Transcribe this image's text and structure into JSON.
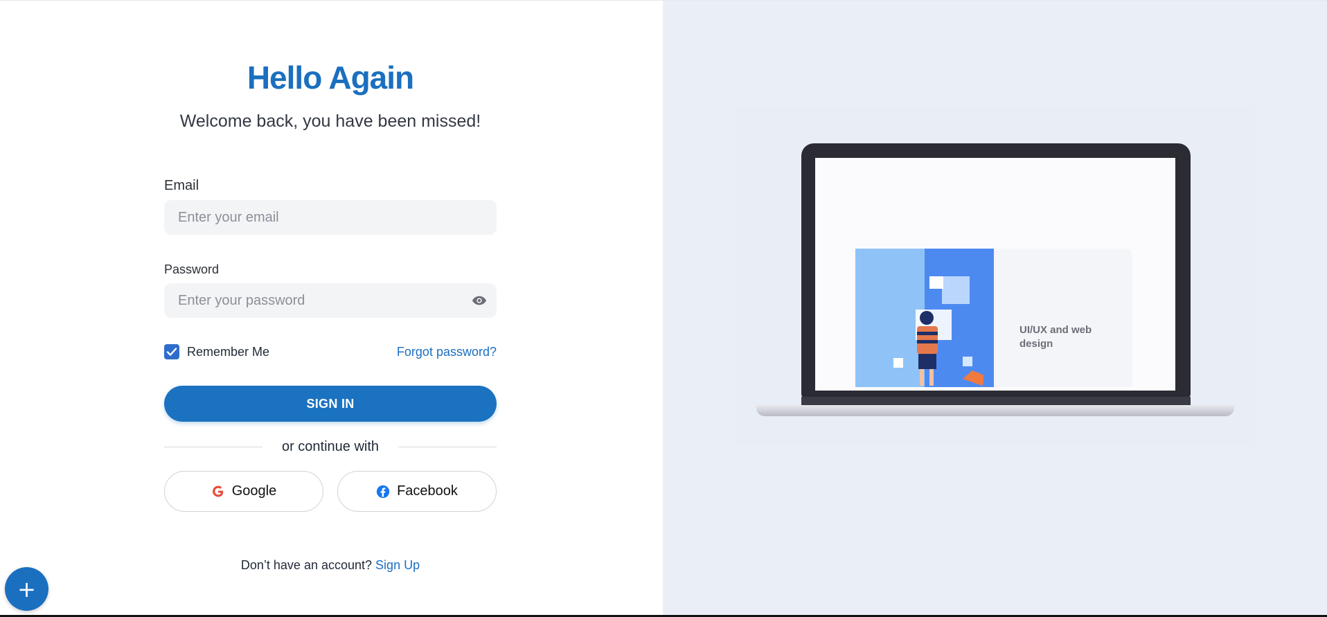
{
  "title": "Hello Again",
  "subtitle": "Welcome back, you have been missed!",
  "email": {
    "label": "Email",
    "placeholder": "Enter your email",
    "value": ""
  },
  "password": {
    "label": "Password",
    "placeholder": "Enter your password",
    "value": ""
  },
  "remember": {
    "label": "Remember Me",
    "checked": true
  },
  "forgot_label": "Forgot password?",
  "signin_label": "SIGN IN",
  "divider_text": "or continue with",
  "social": {
    "google_label": "Google",
    "facebook_label": "Facebook"
  },
  "signup": {
    "prompt": "Don’t have an account?",
    "link": "Sign Up"
  },
  "fab_label": "+",
  "illustration": {
    "caption": "UI/UX and web design"
  },
  "colors": {
    "accent": "#1b6fbf",
    "right_panel_bg": "#eaeff7"
  }
}
